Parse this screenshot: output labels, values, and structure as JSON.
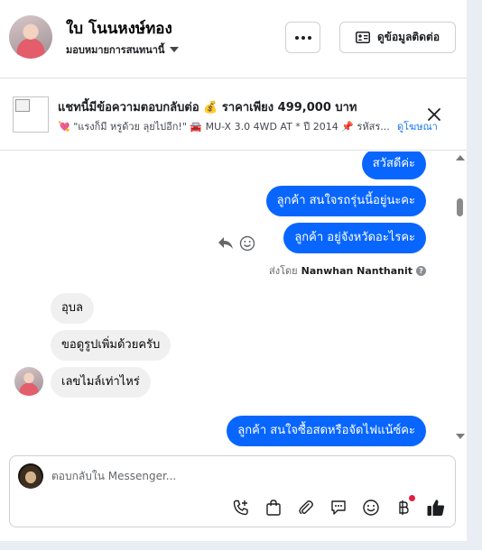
{
  "header": {
    "contact_name": "ใบ โนนหงษ์ทอง",
    "assign_label": "มอบหมายการสนทนานี้",
    "more_label": "More options",
    "contact_info_label": "ดูข้อมูลติดต่อ"
  },
  "ad": {
    "title": "แชทนี้มีข้อความตอบกลับต่อ 💰 ราคาเพียง 499,000 บาท",
    "subtitle": "💘 \"แรงก็มี หรูด้วย ลุยไปอีก!\" 🚘 MU-X 3.0 4WD AT * ปี 2014 📌 รหัสร...",
    "view_ad_label": "ดูโฆษณา"
  },
  "messages": {
    "out_1": "สวัสดีค่ะ",
    "out_2": "ลูกค้า  สนใจรถรุ่นนี้อยู่นะคะ",
    "out_3": "ลูกค้า  อยู่จังหวัดอะไรคะ",
    "sent_by_prefix": "ส่งโดย",
    "sent_by_name": "Nanwhan Nanthanit",
    "in_1": "อุบล",
    "in_2": "ขอดูรูปเพิ่มด้วยครับ",
    "in_3": "เลขไมล์เท่าไหร่",
    "out_4": "ลูกค้า  สนใจซื้อสดหรือจัดไฟแน้ซ์คะ"
  },
  "composer": {
    "placeholder": "ตอบกลับใน Messenger..."
  },
  "icons": {
    "tools": [
      "call-add-icon",
      "shopping-bag-icon",
      "attachment-icon",
      "saved-reply-icon",
      "emoji-icon",
      "baht-icon",
      "like-icon"
    ]
  },
  "colors": {
    "outgoing_bubble": "#0866ff",
    "incoming_bubble": "#f0f0f0",
    "link": "#1877f2",
    "like": "#1c1e21"
  }
}
